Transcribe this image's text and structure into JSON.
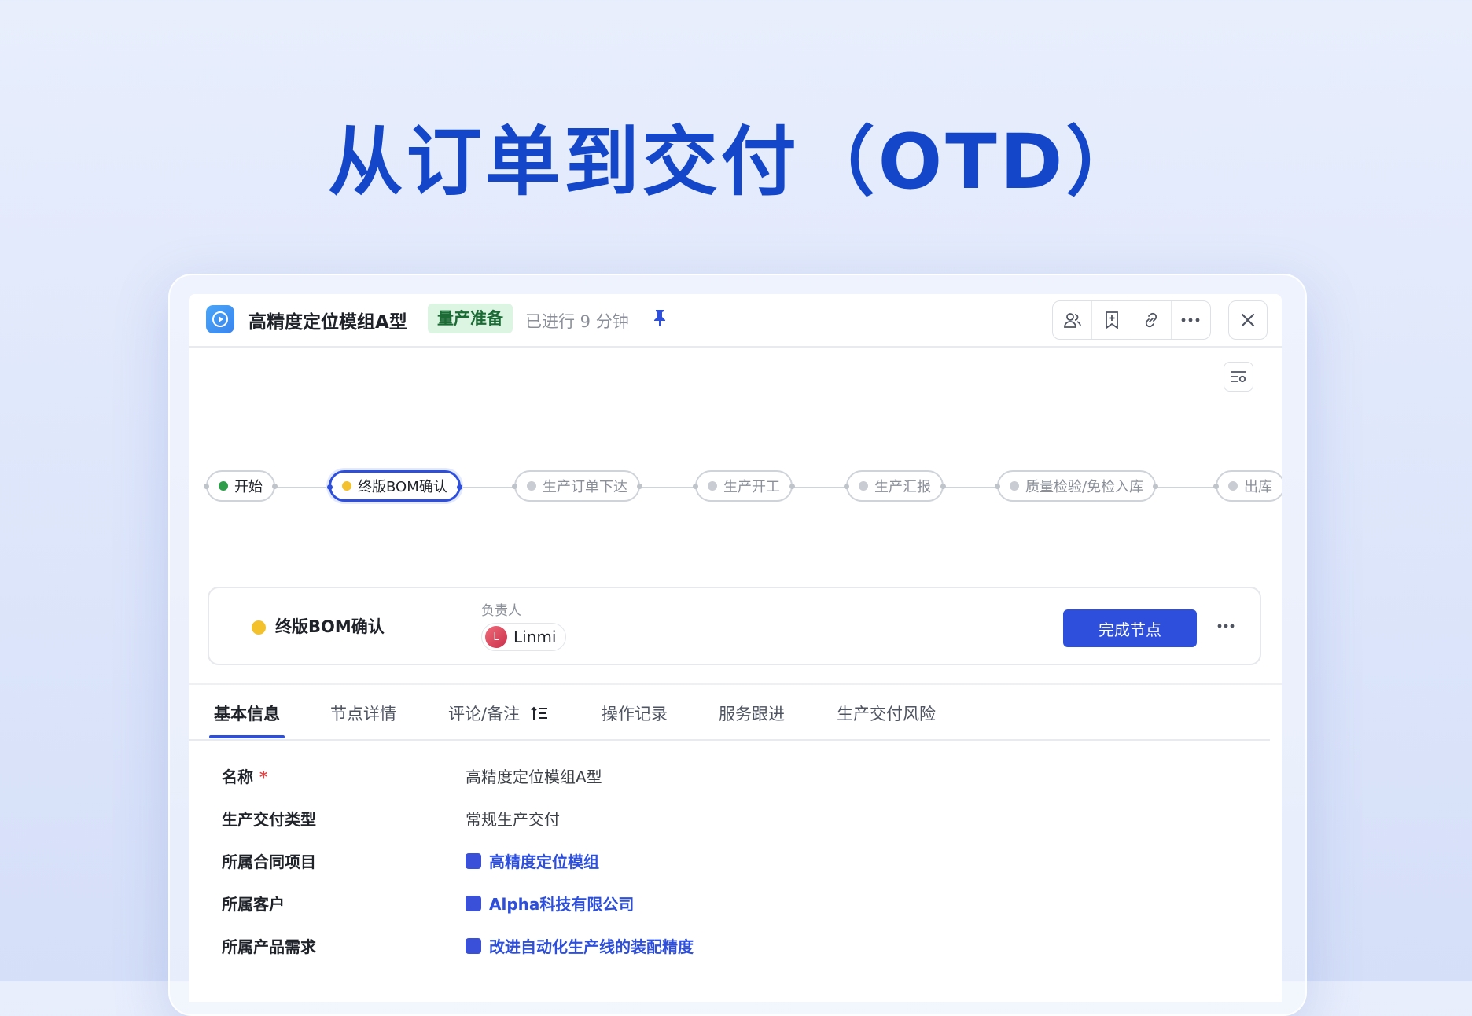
{
  "hero": {
    "title": "从订单到交付（OTD）"
  },
  "header": {
    "title": "高精度定位模组A型",
    "stage_badge": "量产准备",
    "elapsed": "已进行 9 分钟",
    "toolbar_icons": [
      "members-icon",
      "bookmark-icon",
      "link-icon",
      "more-icon"
    ]
  },
  "flow": {
    "nodes": [
      {
        "label": "开始",
        "state": "done"
      },
      {
        "label": "终版BOM确认",
        "state": "active"
      },
      {
        "label": "生产订单下达",
        "state": "pending"
      },
      {
        "label": "生产开工",
        "state": "pending"
      },
      {
        "label": "生产汇报",
        "state": "pending"
      },
      {
        "label": "质量检验/免检入库",
        "state": "pending"
      },
      {
        "label": "出库",
        "state": "pending"
      }
    ]
  },
  "current_node": {
    "name": "终版BOM确认",
    "owner_label": "负责人",
    "owner_initial": "L",
    "owner_name": "Linmi",
    "complete_button": "完成节点"
  },
  "tabs": [
    {
      "label": "基本信息",
      "active": true
    },
    {
      "label": "节点详情",
      "active": false
    },
    {
      "label": "评论/备注",
      "active": false
    },
    {
      "label": "操作记录",
      "active": false
    },
    {
      "label": "服务跟进",
      "active": false
    },
    {
      "label": "生产交付风险",
      "active": false
    }
  ],
  "fields": [
    {
      "label": "名称",
      "required": "*",
      "value": "高精度定位模组A型",
      "type": "text"
    },
    {
      "label": "生产交付类型",
      "value": "常规生产交付",
      "type": "text"
    },
    {
      "label": "所属合同项目",
      "value": "高精度定位模组",
      "type": "link"
    },
    {
      "label": "所属客户",
      "value": "Alpha科技有限公司",
      "type": "link"
    },
    {
      "label": "所属产品需求",
      "value": "改进自动化生产线的装配精度",
      "type": "link"
    }
  ],
  "colors": {
    "accent": "#2d4fdb",
    "hero_title": "#1446c9",
    "stage_badge_bg": "#dcf5e2",
    "done_dot": "#2e9e4a",
    "active_dot": "#f3c12b"
  }
}
